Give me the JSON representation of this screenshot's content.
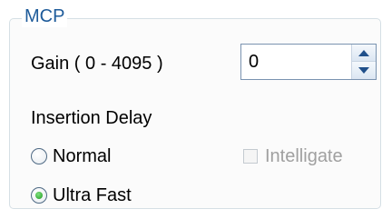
{
  "group": {
    "title": "MCP"
  },
  "gain": {
    "label": "Gain ( 0 - 4095 )",
    "value": "0",
    "range_min": 0,
    "range_max": 4095
  },
  "insertion_delay": {
    "label": "Insertion Delay",
    "options": [
      {
        "label": "Normal",
        "selected": false
      },
      {
        "label": "Ultra Fast",
        "selected": true
      }
    ]
  },
  "intelligate": {
    "label": "Intelligate",
    "checked": false,
    "enabled": false
  },
  "colors": {
    "group_title": "#1e5b9a",
    "group_border": "#d5dfe5",
    "radio_selected": "#1f9a1f",
    "disabled_text": "#a0a0a0"
  },
  "icons": {
    "spin_up": "triangle-up-icon",
    "spin_down": "triangle-down-icon"
  }
}
